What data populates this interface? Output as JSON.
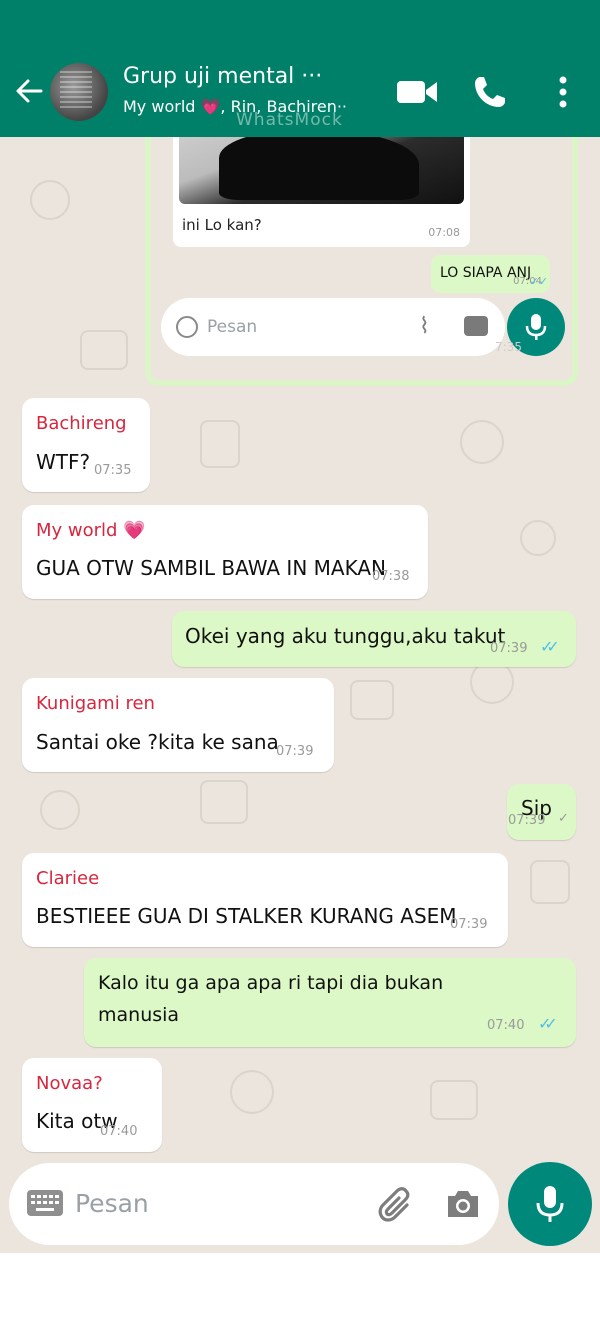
{
  "colors": {
    "header": "#008069",
    "outgoing_bubble": "#dcf8c6",
    "incoming_bubble": "#ffffff",
    "chat_background": "#ece5dd",
    "read_ticks": "#53bdeb",
    "mic_button": "#00897b"
  },
  "header": {
    "title": "Grup uji mental ···",
    "subtitle": "My world 💗, Rin, Bachiren··",
    "watermark": "WhatsMock",
    "icons": [
      "back-arrow-icon",
      "group-avatar",
      "video-call-icon",
      "voice-call-icon",
      "more-options-icon"
    ]
  },
  "embedded_screenshot": {
    "caption": "ini Lo kan?",
    "caption_time": "07:08",
    "outgoing_text": "LO SIAPA ANJ",
    "outgoing_time": "07:04",
    "input_placeholder": "Pesan",
    "overlay_time": "7:35"
  },
  "messages": [
    {
      "direction": "in",
      "sender": "Bachireng",
      "sender_color": "#d7263d",
      "text": "WTF?",
      "time": "07:35"
    },
    {
      "direction": "in",
      "sender": "My world 💗",
      "sender_color": "#d7263d",
      "text": "GUA OTW SAMBIL BAWA IN MAKAN",
      "time": "07:38"
    },
    {
      "direction": "out",
      "text": "Okei yang aku tunggu,aku takut",
      "time": "07:39",
      "ticks": "read"
    },
    {
      "direction": "in",
      "sender": "Kunigami ren",
      "sender_color": "#d7263d",
      "text": "Santai oke ?kita ke sana",
      "time": "07:39"
    },
    {
      "direction": "out",
      "text": "Sip",
      "time": "07:39",
      "ticks": "sent"
    },
    {
      "direction": "in",
      "sender": "Clariee",
      "sender_color": "#d7263d",
      "text": "BESTIEEE GUA DI STALKER KURANG ASEM",
      "time": "07:39"
    },
    {
      "direction": "out",
      "text_line1": "Kalo itu ga apa apa ri tapi dia bukan",
      "text_line2": "manusia",
      "time": "07:40",
      "ticks": "read"
    },
    {
      "direction": "in",
      "sender": "Novaa?",
      "sender_color": "#d7263d",
      "text": "Kita otw",
      "time": "07:40"
    }
  ],
  "input": {
    "placeholder": "Pesan",
    "icons": [
      "keyboard-icon",
      "attach-icon",
      "camera-icon",
      "mic-icon"
    ]
  }
}
